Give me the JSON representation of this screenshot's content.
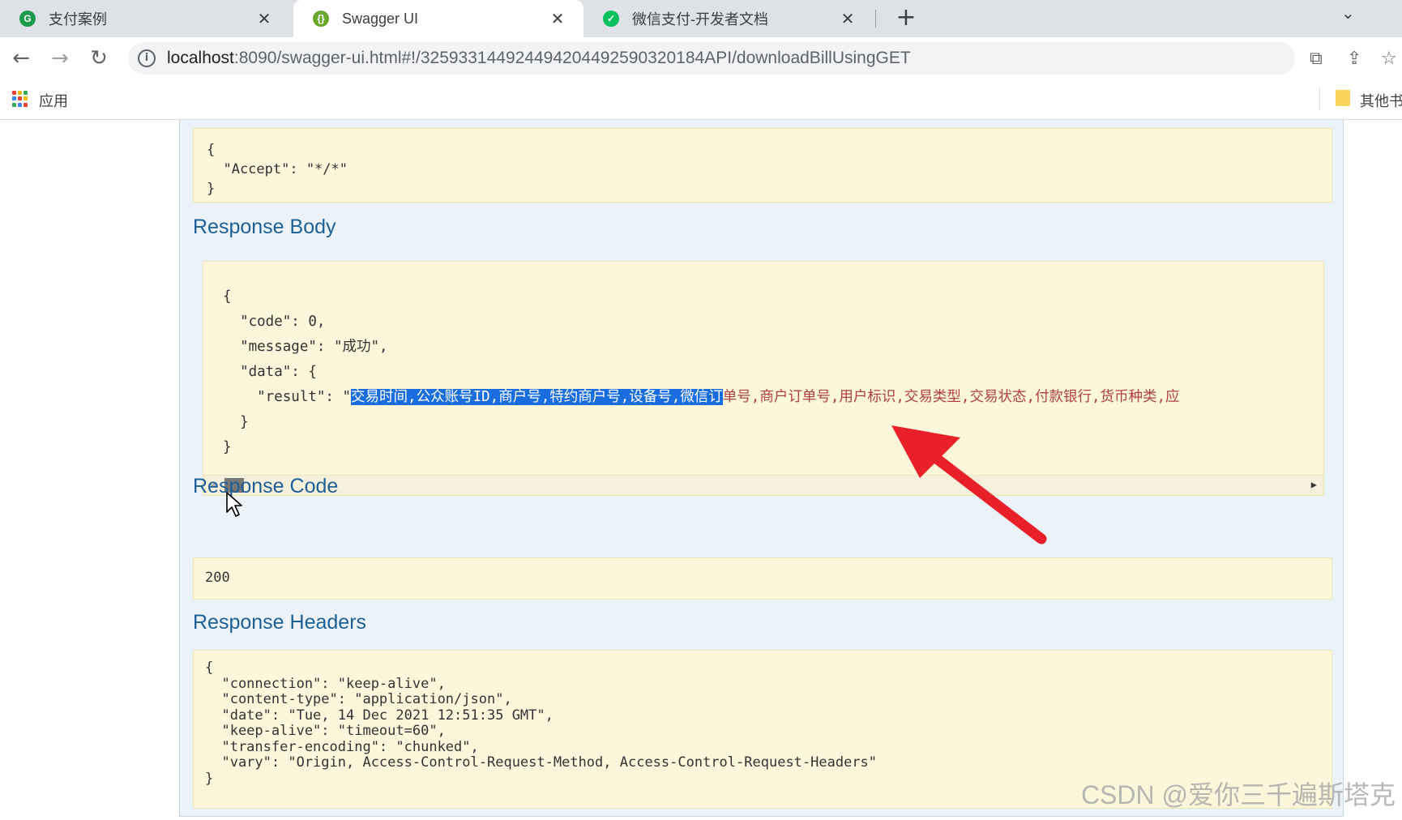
{
  "tabs": [
    {
      "title": "支付案例",
      "active": false,
      "favicon_color": "#1a9a4a",
      "favicon_glyph": "G"
    },
    {
      "title": "Swagger UI",
      "active": true,
      "favicon_color": "#6aa832",
      "favicon_glyph": "{}"
    },
    {
      "title": "微信支付-开发者文档",
      "active": false,
      "favicon_color": "#07c160",
      "favicon_glyph": "✓"
    }
  ],
  "tab_close_glyph": "✕",
  "new_tab_glyph": "+",
  "tab_menu_glyph": "⌄",
  "nav": {
    "back": "←",
    "forward": "→",
    "reload": "↻"
  },
  "address": {
    "host": "localhost",
    "path": ":8090/swagger-ui.html#!/325933144924494204492590320184API/downloadBillUsingGET"
  },
  "bookmarks": {
    "apps_label": "应用",
    "other_label": "其他书"
  },
  "request_headers_json": "{\n  \"Accept\": \"*/*\"\n}",
  "response_body": {
    "title": "Response Body",
    "lines": [
      "{",
      "  \"code\": 0,",
      "  \"message\": \"成功\",",
      "  \"data\": {"
    ],
    "result_prefix": "    \"result\": \"",
    "result_selected": "交易时间,公众账号ID,商户号,特约商户号,设备号,微信订",
    "result_rest": "单号,商户订单号,用户标识,交易类型,交易状态,付款银行,货币种类,应",
    "closing_lines": [
      "  }",
      "}"
    ]
  },
  "response_code": {
    "title": "Response Code",
    "value": "200"
  },
  "response_headers": {
    "title": "Response Headers",
    "json": "{\n  \"connection\": \"keep-alive\",\n  \"content-type\": \"application/json\",\n  \"date\": \"Tue, 14 Dec 2021 12:51:35 GMT\",\n  \"keep-alive\": \"timeout=60\",\n  \"transfer-encoding\": \"chunked\",\n  \"vary\": \"Origin, Access-Control-Request-Method, Access-Control-Request-Headers\"\n}"
  },
  "watermark": "CSDN @爱你三千遍斯塔克",
  "colors": {
    "accent_title": "#1e5f96",
    "selection": "#1a6dde",
    "arrow": "#e8202a",
    "code_bg": "#fcf6db"
  }
}
